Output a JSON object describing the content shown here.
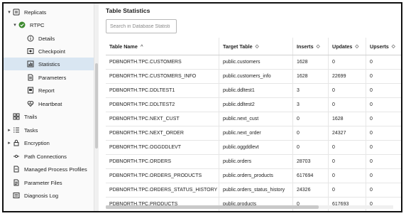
{
  "sidebar": {
    "items": [
      {
        "label": "Replicats",
        "caret": "▾",
        "icon": "replicat-icon"
      },
      {
        "label": "RTPC",
        "caret": "▾",
        "icon": "status-ok-icon"
      },
      {
        "label": "Details",
        "caret": "",
        "icon": "info-icon"
      },
      {
        "label": "Checkpoint",
        "caret": "",
        "icon": "checkpoint-icon"
      },
      {
        "label": "Statistics",
        "caret": "",
        "icon": "chart-icon",
        "selected": true
      },
      {
        "label": "Parameters",
        "caret": "",
        "icon": "document-icon"
      },
      {
        "label": "Report",
        "caret": "",
        "icon": "report-icon"
      },
      {
        "label": "Heartbeat",
        "caret": "",
        "icon": "heartbeat-icon"
      },
      {
        "label": "Trails",
        "caret": "",
        "icon": "trails-icon"
      },
      {
        "label": "Tasks",
        "caret": "▸",
        "icon": "tasks-icon"
      },
      {
        "label": "Encryption",
        "caret": "▸",
        "icon": "lock-icon"
      },
      {
        "label": "Path Connections",
        "caret": "",
        "icon": "connection-icon"
      },
      {
        "label": "Managed Process Profiles",
        "caret": "",
        "icon": "profile-icon"
      },
      {
        "label": "Parameter Files",
        "caret": "",
        "icon": "file-icon"
      },
      {
        "label": "Diagnosis Log",
        "caret": "",
        "icon": "log-icon"
      }
    ]
  },
  "main": {
    "title": "Table Statistics",
    "search_placeholder": "Search in Database Statisti",
    "columns": [
      {
        "label": "Table Name",
        "sort": "^"
      },
      {
        "label": "Target Table",
        "sort": "◇"
      },
      {
        "label": "Inserts",
        "sort": "◇"
      },
      {
        "label": "Updates",
        "sort": "◇"
      },
      {
        "label": "Upserts",
        "sort": "◇"
      }
    ],
    "rows": [
      [
        "PDBNORTH.TPC.CUSTOMERS",
        "public.customers",
        "1628",
        "0",
        "0"
      ],
      [
        "PDBNORTH.TPC.CUSTOMERS_INFO",
        "public.customers_info",
        "1628",
        "22699",
        "0"
      ],
      [
        "PDBNORTH.TPC.DDLTEST1",
        "public.ddltest1",
        "3",
        "0",
        "0"
      ],
      [
        "PDBNORTH.TPC.DDLTEST2",
        "public.ddltest2",
        "3",
        "0",
        "0"
      ],
      [
        "PDBNORTH.TPC.NEXT_CUST",
        "public.next_cust",
        "0",
        "1628",
        "0"
      ],
      [
        "PDBNORTH.TPC.NEXT_ORDER",
        "public.next_order",
        "0",
        "24327",
        "0"
      ],
      [
        "PDBNORTH.TPC.OGGDDLEVT",
        "public.oggddlevt",
        "0",
        "0",
        "0"
      ],
      [
        "PDBNORTH.TPC.ORDERS",
        "public.orders",
        "28703",
        "0",
        "0"
      ],
      [
        "PDBNORTH.TPC.ORDERS_PRODUCTS",
        "public.orders_products",
        "617694",
        "0",
        "0"
      ],
      [
        "PDBNORTH.TPC.ORDERS_STATUS_HISTORY",
        "public.orders_status_history",
        "24326",
        "0",
        "0"
      ],
      [
        "PDBNORTH.TPC.PRODUCTS",
        "public.products",
        "0",
        "617693",
        "0"
      ]
    ]
  },
  "colors": {
    "selected_bg": "#d9e6f2",
    "status_ok": "#3c8a2e"
  }
}
